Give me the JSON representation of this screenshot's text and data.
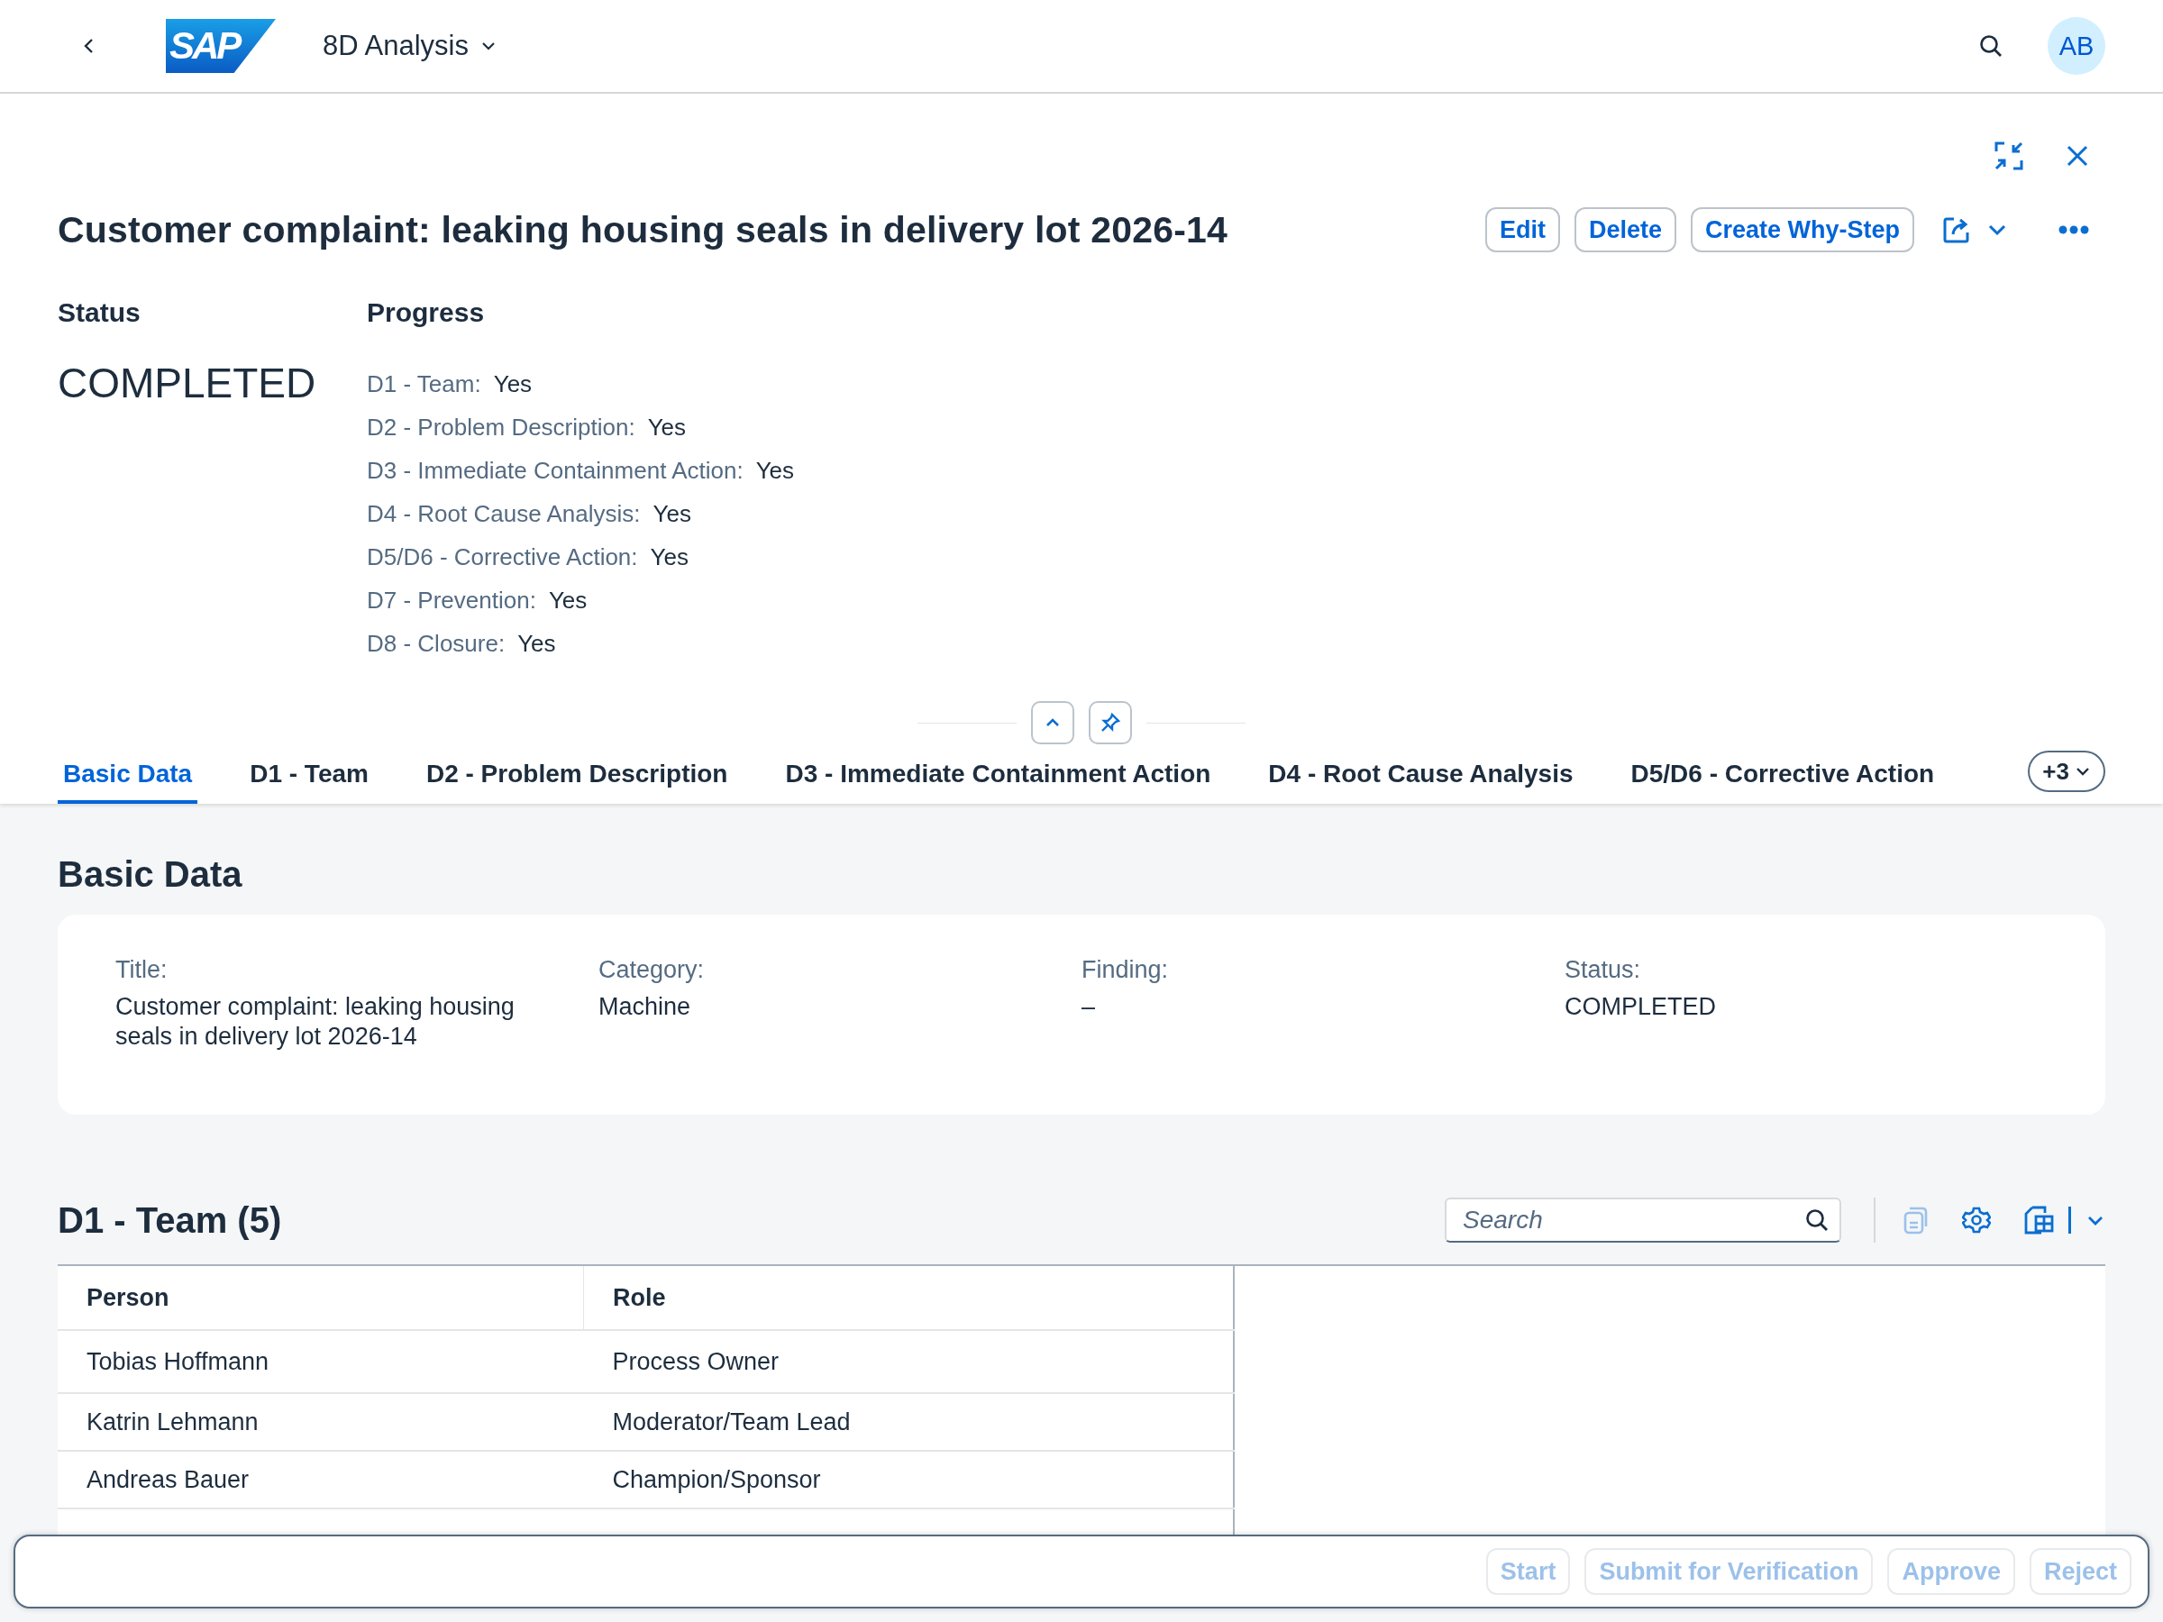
{
  "shell": {
    "logo": "SAP",
    "app_title": "8D Analysis",
    "avatar": "AB"
  },
  "header": {
    "title": "Customer complaint: leaking housing seals in delivery lot 2026-14",
    "actions": [
      "Edit",
      "Delete",
      "Create Why-Step"
    ],
    "status_label": "Status",
    "status": "COMPLETED",
    "progress_label": "Progress",
    "progress": [
      {
        "label": "D1 - Team:",
        "value": "Yes"
      },
      {
        "label": "D2 - Problem Description:",
        "value": "Yes"
      },
      {
        "label": "D3 - Immediate Containment Action:",
        "value": "Yes"
      },
      {
        "label": "D4 - Root Cause Analysis:",
        "value": "Yes"
      },
      {
        "label": "D5/D6 - Corrective Action:",
        "value": "Yes"
      },
      {
        "label": "D7 - Prevention:",
        "value": "Yes"
      },
      {
        "label": "D8 - Closure:",
        "value": "Yes"
      }
    ]
  },
  "tabs": [
    {
      "label": "Basic Data",
      "selected": true
    },
    {
      "label": "D1 - Team",
      "selected": false
    },
    {
      "label": "D2 - Problem Description",
      "selected": false
    },
    {
      "label": "D3 - Immediate Containment Action",
      "selected": false
    },
    {
      "label": "D4 - Root Cause Analysis",
      "selected": false
    },
    {
      "label": "D5/D6 - Corrective Action",
      "selected": false
    }
  ],
  "tabs_overflow": "+3",
  "basic_data": {
    "heading": "Basic Data",
    "fields": [
      {
        "label": "Title:",
        "value": "Customer complaint: leaking housing seals in delivery lot 2026-14"
      },
      {
        "label": "Category:",
        "value": "Machine"
      },
      {
        "label": "Finding:",
        "value": "–"
      },
      {
        "label": "Status:",
        "value": "COMPLETED"
      }
    ]
  },
  "team": {
    "heading": "D1 - Team (5)",
    "search": {
      "placeholder": "Search"
    },
    "columns": [
      "Person",
      "Role"
    ],
    "rows": [
      [
        "Tobias Hoffmann",
        "Process Owner"
      ],
      [
        "Katrin Lehmann",
        "Moderator/Team Lead"
      ],
      [
        "Andreas Bauer",
        "Champion/Sponsor"
      ]
    ]
  },
  "footer": {
    "buttons": [
      {
        "label": "Start",
        "disabled": true
      },
      {
        "label": "Submit for Verification",
        "disabled": true
      },
      {
        "label": "Approve",
        "disabled": true
      },
      {
        "label": "Reject",
        "disabled": true
      }
    ]
  }
}
